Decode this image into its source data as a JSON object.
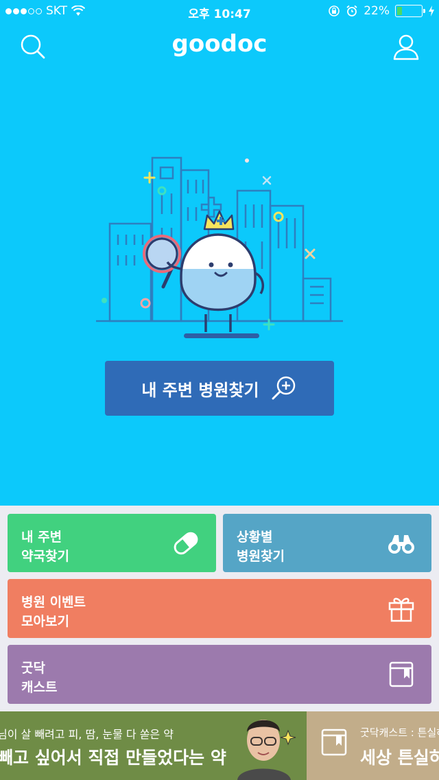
{
  "status_bar": {
    "carrier": "SKT",
    "time": "오후 10:47",
    "battery_percent": "22%",
    "battery_level": 0.22
  },
  "header": {
    "logo": "goodoc",
    "search_icon": "search-icon",
    "profile_icon": "user-icon"
  },
  "hero": {
    "find_button_label": "내 주변 병원찾기"
  },
  "tiles": {
    "pharmacy": {
      "line1": "내 주변",
      "line2": "약국찾기",
      "icon": "pill-icon"
    },
    "situation": {
      "line1": "상황별",
      "line2": "병원찾기",
      "icon": "binoculars-icon"
    },
    "event": {
      "line1": "병원 이벤트",
      "line2": "모아보기",
      "icon": "gift-icon"
    },
    "cast": {
      "line1": "굿닥",
      "line2": "캐스트",
      "icon": "bookmark-book-icon"
    }
  },
  "banner": {
    "slide1": {
      "sub": "님이 살 빼려고 피, 땀, 눈물 다 쏟은 약",
      "main": "빼고 싶어서 직접 만들었다는 약"
    },
    "slide2": {
      "sub": "굿닥캐스트 : 튼실하",
      "main": "세상 튼실하"
    },
    "pages": 8,
    "active_page": 1
  },
  "colors": {
    "background": "#0cc9fb",
    "find_button": "#2f6bb7",
    "pharmacy_tile": "#41d17f",
    "situation_tile": "#55a5c6",
    "event_tile": "#f07e61",
    "cast_tile": "#9c7aad"
  }
}
